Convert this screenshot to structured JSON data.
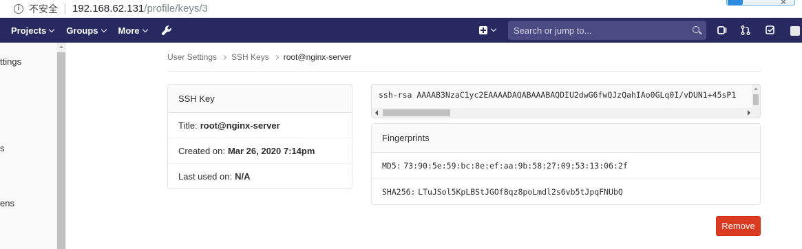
{
  "browser": {
    "security_label": "不安全",
    "url_host": "192.168.62.131",
    "url_path": "/profile/keys/3"
  },
  "navbar": {
    "menus": [
      "Projects",
      "Groups",
      "More"
    ],
    "search_placeholder": "Search or jump to...",
    "bg_color": "#292961"
  },
  "sidebar": {
    "items": [
      "ttings",
      "s",
      "ens"
    ]
  },
  "breadcrumb": {
    "items": [
      "User Settings",
      "SSH Keys",
      "root@nginx-server"
    ]
  },
  "ssh_key_card": {
    "header": "SSH Key",
    "title_label": "Title:",
    "title_value": "root@nginx-server",
    "created_label": "Created on:",
    "created_value": "Mar 26, 2020 7:14pm",
    "last_used_label": "Last used on:",
    "last_used_value": "N/A"
  },
  "key_text": "ssh-rsa AAAAB3NzaC1yc2EAAAADAQABAAABAQDIU2dwG6fwQJzQahIAo0GLq0I/vDUN1+45sP1",
  "fingerprints": {
    "header": "Fingerprints",
    "md5_label": "MD5:",
    "md5_value": "73:90:5e:59:bc:8e:ef:aa:9b:58:27:09:53:13:06:2f",
    "sha256_label": "SHA256:",
    "sha256_value": "LTuJSol5KpLBStJGOf8qz8poLmdl2s6vb5tJpqFNUbQ"
  },
  "actions": {
    "remove_label": "Remove",
    "remove_color": "#db3b21"
  }
}
